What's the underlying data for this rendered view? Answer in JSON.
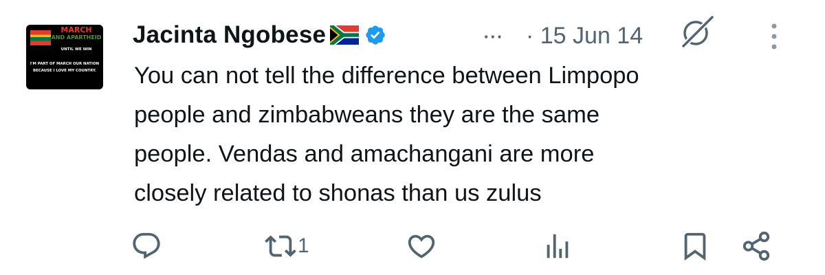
{
  "avatar": {
    "title_line1": "MARCH",
    "title_line2": "AND APARTHEID",
    "tagline": "UNTIL WE WIN",
    "caption": "I'M PART OF MARCH OUR NATION BECAUSE I LOVE MY COUNTRY."
  },
  "author": {
    "display_name": "Jacinta Ngobese",
    "flag": "south-africa-flag",
    "verified": true
  },
  "meta": {
    "more_label": "···",
    "date": "· 15 Jun 14"
  },
  "tweet": {
    "text": "You can not tell the difference between Limpopo\npeople and zimbabweans they are the same\npeople. Vendas and amachangani are more\nclosely related to shonas than us zulus"
  },
  "actions": {
    "reply_icon": "reply-icon",
    "retweet_icon": "retweet-icon",
    "retweet_count": "1",
    "like_icon": "heart-icon",
    "views_icon": "bar-chart-icon",
    "bookmark_icon": "bookmark-icon",
    "share_icon": "share-icon"
  },
  "colors": {
    "text_primary": "#0f1419",
    "text_secondary": "#536471",
    "verified_blue": "#1d9bf0"
  }
}
